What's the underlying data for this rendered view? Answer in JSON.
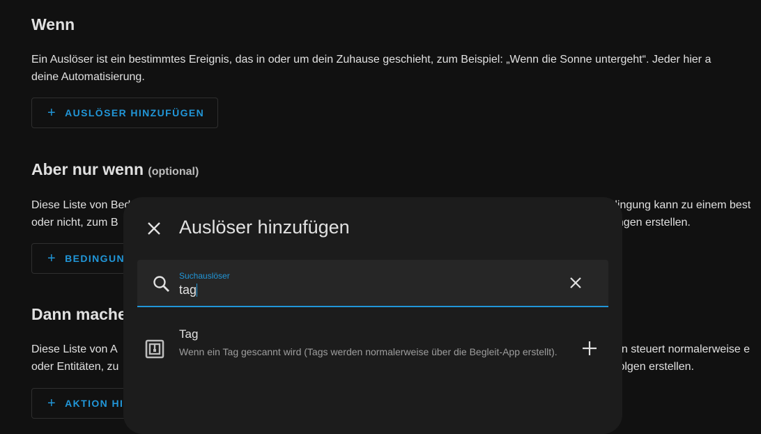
{
  "sections": {
    "when": {
      "title": "Wenn",
      "desc_line1": "Ein Auslöser ist ein bestimmtes Ereignis, das in oder um dein Zuhause geschieht, zum Beispiel: „Wenn die Sonne untergeht“. Jeder hier a",
      "desc_line2": "deine Automatisierung.",
      "button_label": "AUSLÖSER HINZUFÜGEN"
    },
    "condition": {
      "title": "Aber nur wenn",
      "optional": "(optional)",
      "desc_line1_left": "Diese Liste von Bed",
      "desc_line1_right": "dingung kann zu einem best",
      "desc_line2_left": "oder nicht, zum B",
      "desc_line2_right": "ungen erstellen.",
      "button_label": "BEDINGUN"
    },
    "action": {
      "title": "Dann mache",
      "desc_line1_left": "Diese Liste von A",
      "desc_line1_right": "on steuert normalerweise e",
      "desc_line2_left": "oder Entitäten, zu",
      "desc_line2_right": "folgen erstellen.",
      "button_label": "AKTION HI"
    }
  },
  "dialog": {
    "title": "Auslöser hinzufügen",
    "close_icon": "close-icon",
    "search": {
      "label": "Suchauslöser",
      "value": "tag"
    },
    "results": [
      {
        "icon": "nfc-tag-icon",
        "title": "Tag",
        "description": "Wenn ein Tag gescannt wird (Tags werden normalerweise über die Begleit-App erstellt)."
      }
    ]
  },
  "colors": {
    "accent": "#2196d8",
    "background": "#111111",
    "dialog": "#1c1c1c"
  }
}
